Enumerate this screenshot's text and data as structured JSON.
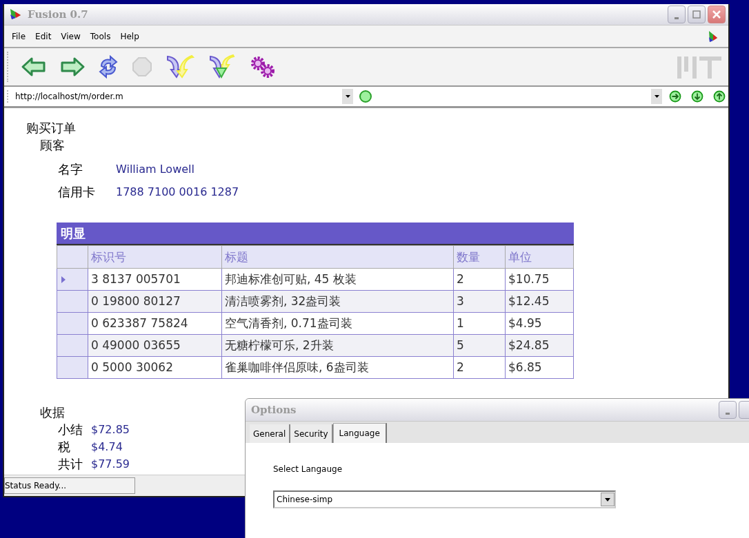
{
  "window": {
    "title": "Fusion 0.7"
  },
  "menu": [
    "File",
    "Edit",
    "View",
    "Tools",
    "Help"
  ],
  "address_bar": {
    "value": "http://localhost/m/order.m"
  },
  "document": {
    "title": "购买订单",
    "customer": {
      "heading": "顾客",
      "fields": [
        {
          "label": "名字",
          "value": "William Lowell"
        },
        {
          "label": "信用卡",
          "value": "1788 7100 0016 1287"
        }
      ]
    },
    "table": {
      "title": "明显",
      "columns": [
        "标识号",
        "标题",
        "数量",
        "单位"
      ],
      "rows": [
        {
          "selected": true,
          "cells": [
            "3 8137 005701",
            "邦迪标准创可贴, 45 枚装",
            "2",
            "$10.75"
          ]
        },
        {
          "selected": false,
          "cells": [
            "0 19800 80127",
            "清洁喷雾剂, 32盎司装",
            "3",
            "$12.45"
          ]
        },
        {
          "selected": false,
          "cells": [
            "0 623387 75824",
            "空气清香剂, 0.71盎司装",
            "1",
            "$4.95"
          ]
        },
        {
          "selected": false,
          "cells": [
            "0 49000 03655",
            "无糖柠檬可乐, 2升装",
            "5",
            "$24.85"
          ]
        },
        {
          "selected": false,
          "cells": [
            "0 5000 30062",
            "雀巢咖啡伴侣原味, 6盎司装",
            "2",
            "$6.85"
          ]
        }
      ]
    },
    "receipt": {
      "heading": "收据",
      "fields": [
        {
          "label": "小结",
          "value": "$72.85"
        },
        {
          "label": "税",
          "value": "$4.74"
        },
        {
          "label": "共计",
          "value": "$77.59"
        }
      ]
    }
  },
  "status_bar": "Status Ready...",
  "options_dialog": {
    "title": "Options",
    "tabs": [
      {
        "label": "General",
        "selected": false
      },
      {
        "label": "Security",
        "selected": false
      },
      {
        "label": "Language",
        "selected": true
      }
    ],
    "label": "Select Langauge",
    "select": {
      "value": "Chinese-simp"
    }
  }
}
